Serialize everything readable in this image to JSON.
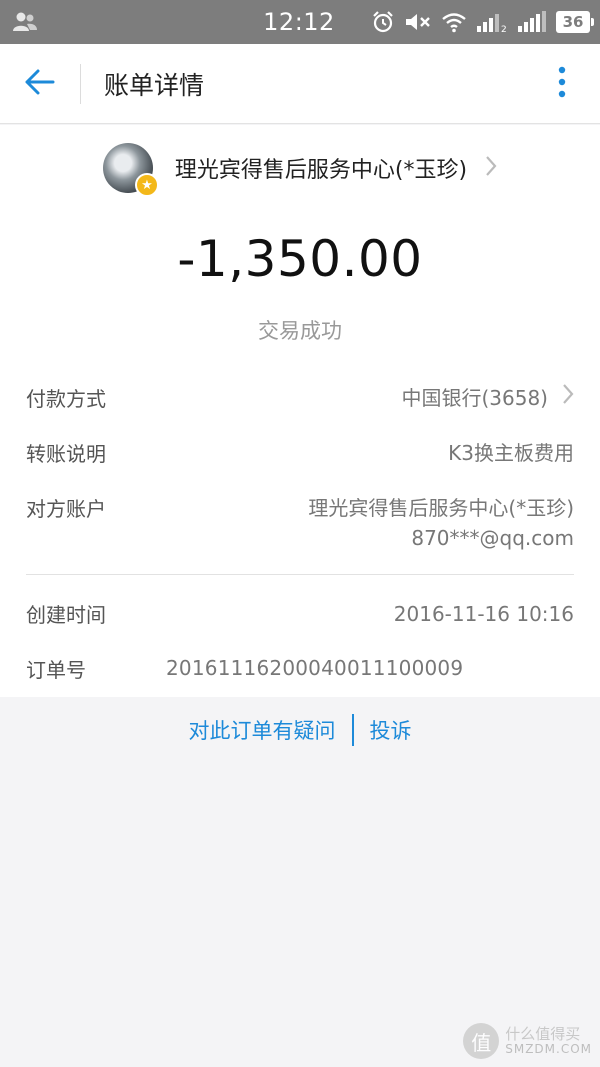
{
  "status_bar": {
    "time": "12:12",
    "battery": "36",
    "icons": [
      "people-icon",
      "alarm-icon",
      "mute-icon",
      "wifi-icon",
      "signal-icon",
      "signal-icon",
      "battery-icon"
    ]
  },
  "header": {
    "title": "账单详情",
    "back_icon": "arrow-left-icon",
    "more_icon": "more-vertical-icon",
    "accent_color": "#1d8ad9"
  },
  "merchant": {
    "name": "理光宾得售后服务中心(*玉珍)"
  },
  "amount": "-1,350.00",
  "status": "交易成功",
  "details": {
    "payment_method_label": "付款方式",
    "payment_method_value": "中国银行(3658)",
    "transfer_note_label": "转账说明",
    "transfer_note_value": "K3换主板费用",
    "counterparty_label": "对方账户",
    "counterparty_name": "理光宾得售后服务中心(*玉珍)",
    "counterparty_account": "870***@qq.com",
    "created_label": "创建时间",
    "created_value": "2016-11-16 10:16",
    "order_label": "订单号",
    "order_value": "20161116200040011100009"
  },
  "links": {
    "question": "对此订单有疑问",
    "complain": "投诉"
  },
  "watermark": {
    "logo": "值",
    "text_cn": "什么值得买",
    "text_en": "SMZDM.COM"
  }
}
